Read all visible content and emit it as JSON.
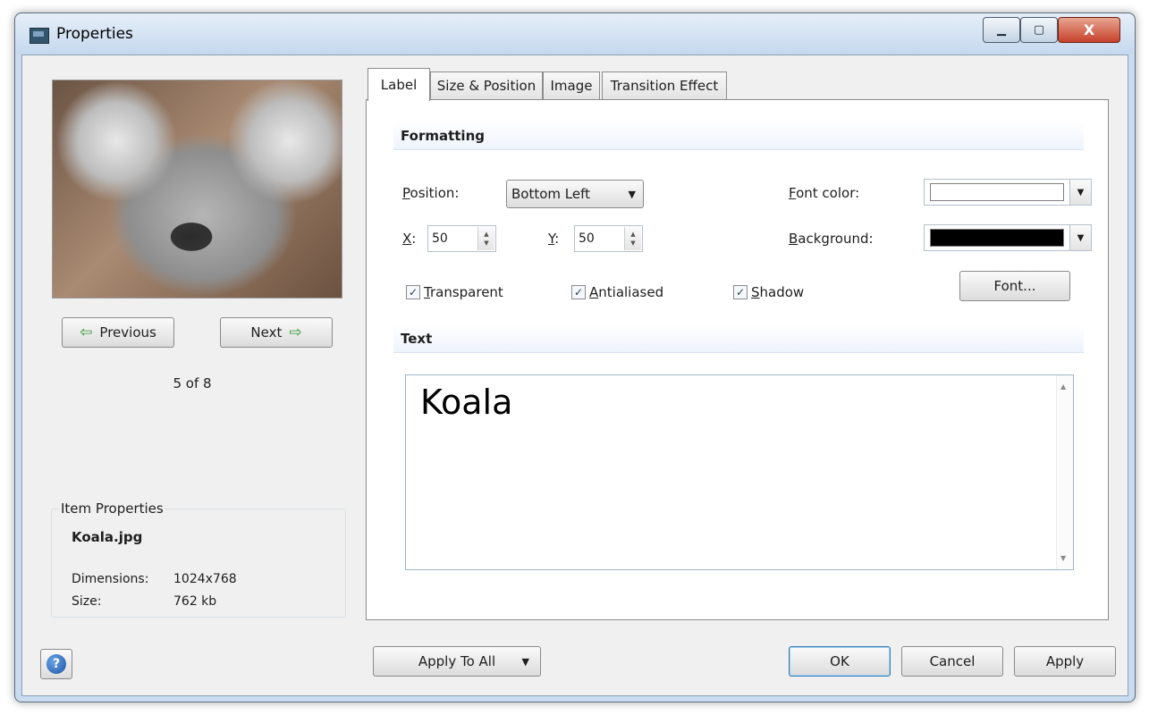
{
  "window": {
    "title": "Properties",
    "close_glyph": "X",
    "minimize_glyph": "▁",
    "maximize_glyph": "▢"
  },
  "preview": {
    "image_alt": "koala photo",
    "previous_label": "Previous",
    "next_label": "Next",
    "counter": "5 of 8"
  },
  "item_properties": {
    "group_title": "Item Properties",
    "file_name": "Koala.jpg",
    "dimensions_label": "Dimensions:",
    "dimensions_value": "1024x768",
    "size_label": "Size:",
    "size_value": "762 kb"
  },
  "tabs": [
    {
      "label": "Label",
      "active": true
    },
    {
      "label": "Size & Position",
      "active": false
    },
    {
      "label": "Image",
      "active": false
    },
    {
      "label": "Transition Effect",
      "active": false
    }
  ],
  "formatting": {
    "header": "Formatting",
    "position_label_key": "P",
    "position_label_rest": "osition:",
    "position_value": "Bottom Left",
    "x_label_key": "X",
    "x_label_rest": ":",
    "x_value": "50",
    "y_label_key": "Y",
    "y_label_rest": ":",
    "y_value": "50",
    "font_color_label_key": "F",
    "font_color_label_rest": "ont color:",
    "font_color": "#ffffff",
    "background_label_key": "B",
    "background_label_rest": "ackground:",
    "background_color": "#000000",
    "transparent_key": "T",
    "transparent_rest": "ransparent",
    "transparent_checked": true,
    "antialiased_key": "A",
    "antialiased_rest": "ntialiased",
    "antialiased_checked": true,
    "shadow_key": "S",
    "shadow_rest": "hadow",
    "shadow_checked": true,
    "font_button_label": "Font..."
  },
  "text_section": {
    "header": "Text",
    "value": "Koala"
  },
  "footer": {
    "help_glyph": "?",
    "apply_to_all_label": "Apply To All",
    "ok_label": "OK",
    "cancel_label": "Cancel",
    "apply_label": "Apply"
  },
  "icons": {
    "arrow_left": "⇦",
    "arrow_right": "⇨",
    "dropdown_caret": "▼",
    "check": "✓",
    "scroll_up": "▲",
    "scroll_down": "▼"
  }
}
